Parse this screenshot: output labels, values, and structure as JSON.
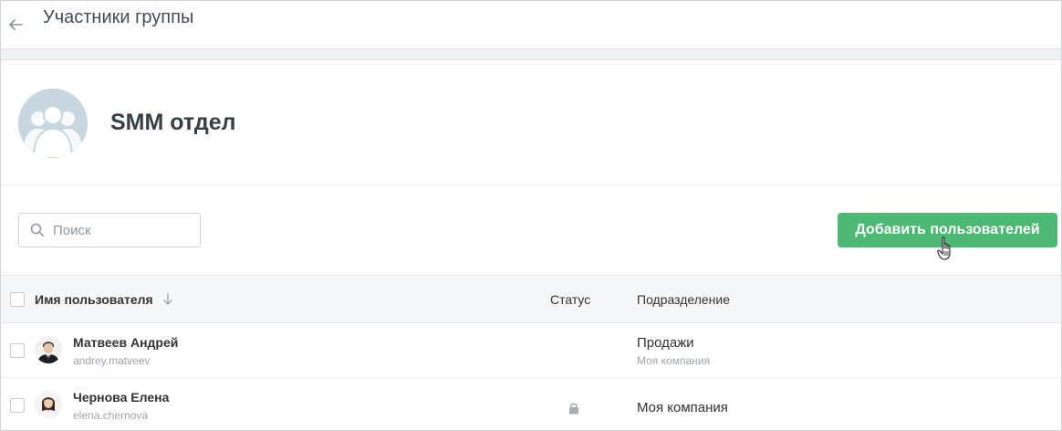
{
  "header": {
    "title": "Участники группы",
    "back_icon": "arrow-left-icon"
  },
  "group": {
    "name": "SMM отдел",
    "avatar_icon": "group-users-icon"
  },
  "toolbar": {
    "search_placeholder": "Поиск",
    "search_value": "",
    "add_button_label": "Добавить пользователей"
  },
  "table": {
    "columns": {
      "name": "Имя пользователя",
      "status": "Статус",
      "department": "Подразделение"
    },
    "sort": "descending",
    "rows": [
      {
        "name": "Матвеев Андрей",
        "login": "andrey.matveev",
        "status_icon": "",
        "department": "Продажи",
        "department_sub": "Моя компания"
      },
      {
        "name": "Чернова Елена",
        "login": "elena.chernova",
        "status_icon": "lock-icon",
        "department": "Моя компания",
        "department_sub": ""
      }
    ]
  },
  "colors": {
    "accent": "#4cb873",
    "title_text": "#444b52",
    "muted_text": "#a0a5aa",
    "table_header_bg": "#f6f7f9",
    "group_avatar_bg": "#c8d6df"
  }
}
